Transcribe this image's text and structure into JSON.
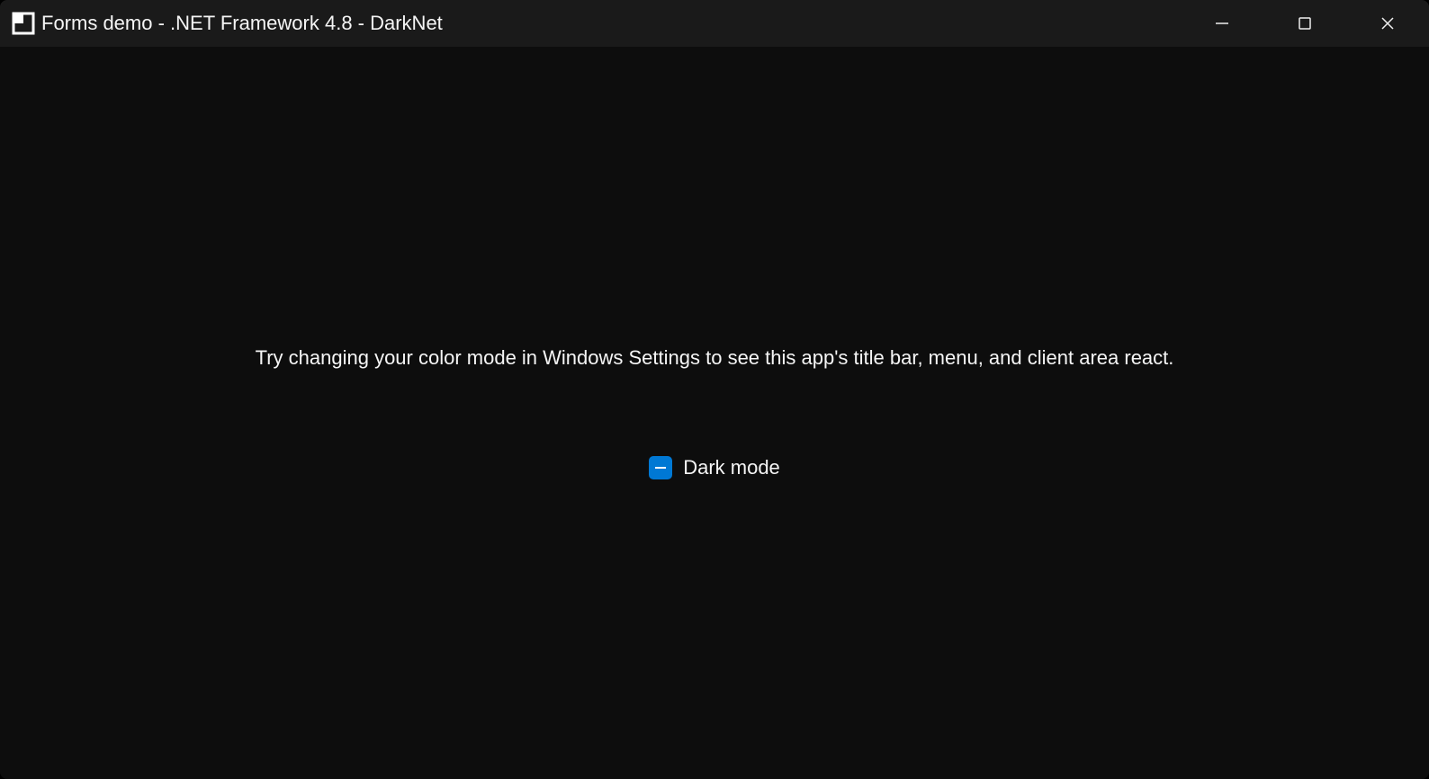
{
  "titlebar": {
    "title": "Forms demo - .NET Framework 4.8 - DarkNet"
  },
  "client": {
    "instruction": "Try changing your color mode in Windows Settings to see this app's title bar, menu, and client area react.",
    "checkbox_label": "Dark mode"
  },
  "colors": {
    "titlebar_bg": "#1a1a1a",
    "client_bg": "#0d0d0d",
    "text": "#f5f5f5",
    "checkbox_accent": "#0078d4"
  }
}
